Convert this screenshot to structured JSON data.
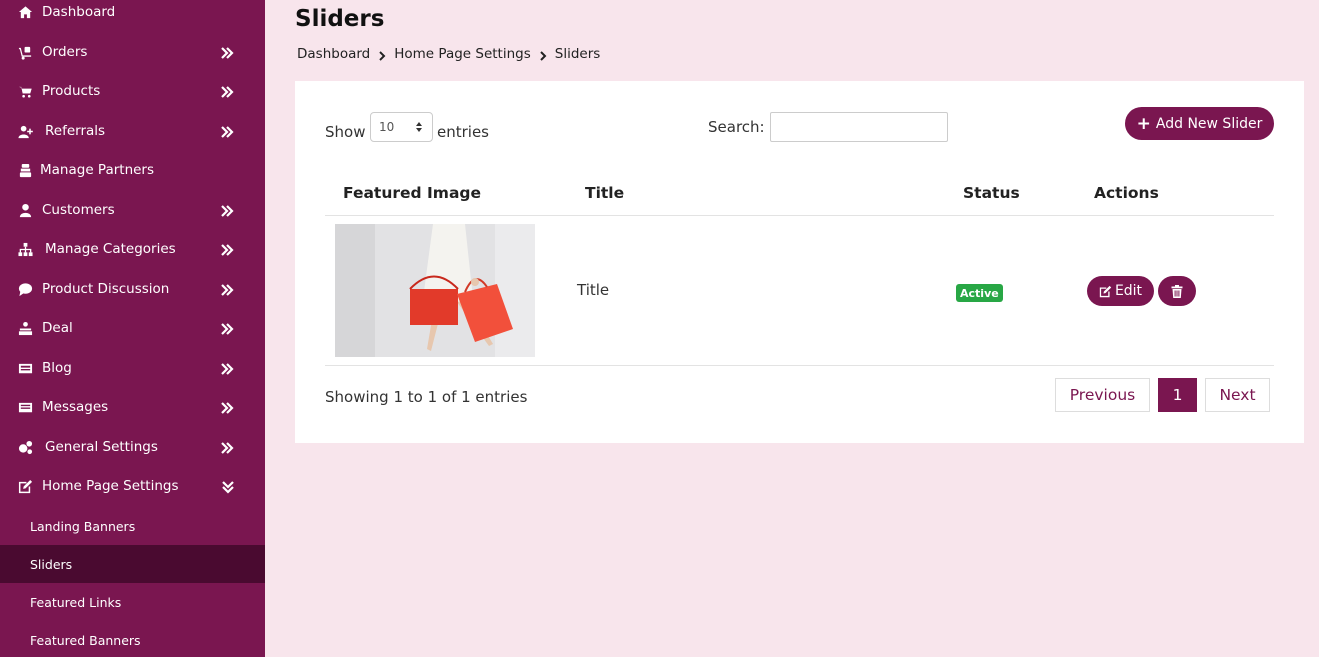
{
  "sidebar": {
    "items": [
      {
        "label": "Dashboard",
        "icon": "home-icon",
        "chevron": "none"
      },
      {
        "label": "Orders",
        "icon": "dolly-icon",
        "chevron": "right"
      },
      {
        "label": "Products",
        "icon": "cart-icon",
        "chevron": "right"
      },
      {
        "label": "Referrals",
        "icon": "user-plus-icon",
        "chevron": "right"
      },
      {
        "label": "Manage Partners",
        "icon": "partners-icon",
        "chevron": "none"
      },
      {
        "label": "Customers",
        "icon": "user-icon",
        "chevron": "right"
      },
      {
        "label": "Manage Categories",
        "icon": "sitemap-icon",
        "chevron": "right"
      },
      {
        "label": "Product Discussion",
        "icon": "comment-icon",
        "chevron": "right"
      },
      {
        "label": "Deal",
        "icon": "deal-icon",
        "chevron": "right"
      },
      {
        "label": "Blog",
        "icon": "blog-icon",
        "chevron": "right"
      },
      {
        "label": "Messages",
        "icon": "messages-icon",
        "chevron": "right"
      },
      {
        "label": "General Settings",
        "icon": "cogs-icon",
        "chevron": "right"
      },
      {
        "label": "Home Page Settings",
        "icon": "edit-icon",
        "chevron": "down"
      }
    ],
    "sub_items": [
      {
        "label": "Landing Banners",
        "active": false
      },
      {
        "label": "Sliders",
        "active": true
      },
      {
        "label": "Featured Links",
        "active": false
      },
      {
        "label": "Featured Banners",
        "active": false
      }
    ]
  },
  "header": {
    "title": "Sliders",
    "breadcrumb": [
      "Dashboard",
      "Home Page Settings",
      "Sliders"
    ]
  },
  "table_controls": {
    "show_label": "Show",
    "page_length": "10",
    "entries_label": "entries",
    "search_label": "Search:",
    "search_value": "",
    "add_button": "Add New Slider"
  },
  "table": {
    "columns": [
      "Featured Image",
      "Title",
      "Status",
      "Actions"
    ],
    "rows": [
      {
        "image": "woman-with-red-shopping-bags",
        "title": "Title",
        "status": "Active",
        "edit_label": "Edit"
      }
    ]
  },
  "footer": {
    "info": "Showing 1 to 1 of 1 entries",
    "previous": "Previous",
    "current_page": "1",
    "next": "Next"
  },
  "colors": {
    "brand": "#7a1650",
    "brand_dark": "#4a0a30",
    "background": "#f8e5ec",
    "status_active": "#28a745"
  }
}
